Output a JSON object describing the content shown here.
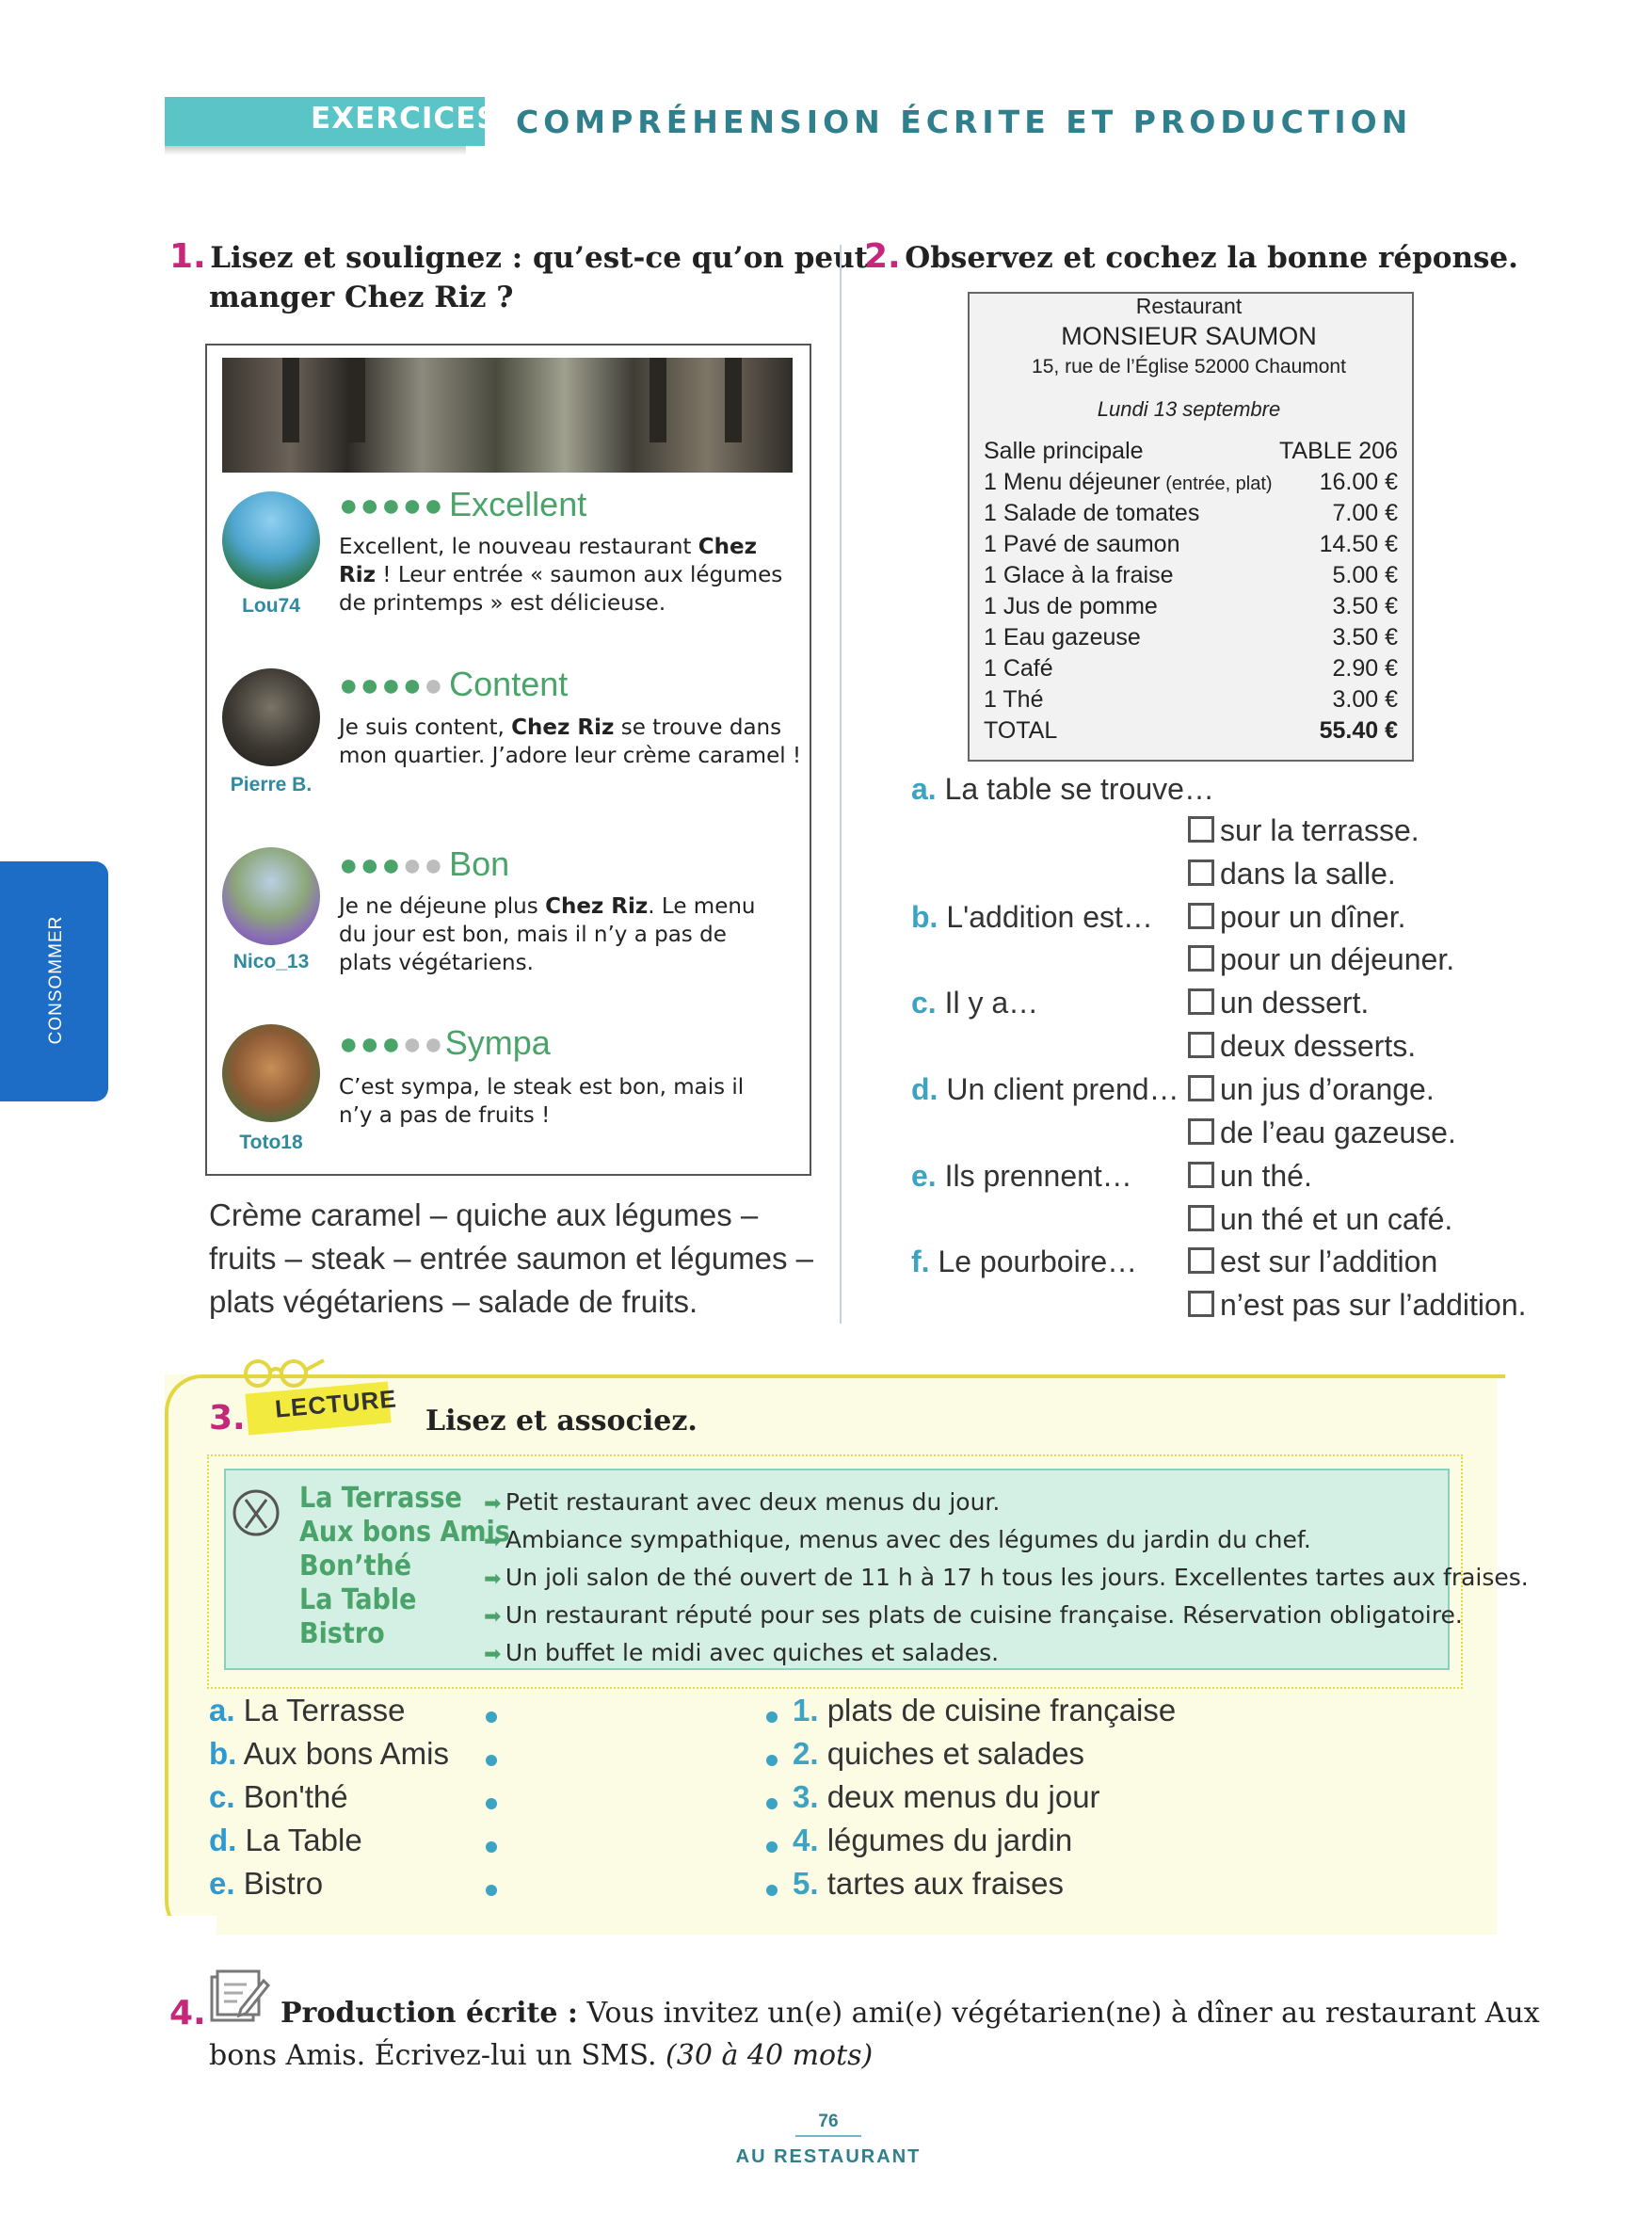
{
  "header": {
    "tag": "EXERCICES",
    "title": "COMPRÉHENSION ÉCRITE ET PRODUCTION"
  },
  "side_tab": "CONSOMMER",
  "ex1": {
    "number": "1.",
    "instruction_line1": "Lisez et soulignez : qu’est-ce qu’on peut",
    "instruction_line2": "manger Chez Riz ?",
    "reviews": [
      {
        "user": "Lou74",
        "title": "Excellent",
        "stars": 5,
        "l1a": "Excellent, le nouveau restaurant ",
        "l1b": "Chez",
        "l2a": "Riz",
        "l2b": " ! Leur entrée « saumon aux légumes",
        "l3": "de printemps » est délicieuse."
      },
      {
        "user": "Pierre B.",
        "title": "Content",
        "stars": 4,
        "l1a": "Je suis content, ",
        "l1b": "Chez Riz",
        "l1c": " se trouve dans",
        "l2": "mon quartier. J’adore leur crème caramel !"
      },
      {
        "user": "Nico_13",
        "title": "Bon",
        "stars": 3,
        "l1a": "Je ne déjeune plus ",
        "l1b": "Chez Riz",
        "l1c": ". Le menu",
        "l2": "du jour est bon, mais il n’y a pas de",
        "l3": "plats végétariens."
      },
      {
        "user": "Toto18",
        "title": "Sympa",
        "stars": 3,
        "l1": "C’est sympa, le steak est bon, mais il",
        "l2": "n’y a pas de fruits !"
      }
    ],
    "food_line1": "Crème caramel – quiche aux légumes –",
    "food_line2": "fruits – steak – entrée saumon et légumes –",
    "food_line3": "plats végétariens – salade de fruits."
  },
  "ex2": {
    "number": "2.",
    "instruction": "Observez et cochez la bonne réponse.",
    "receipt": {
      "label": "Restaurant",
      "name": "MONSIEUR SAUMON",
      "address": "15, rue de l’Église 52000 Chaumont",
      "date": "Lundi 13 septembre",
      "room": "Salle principale",
      "table": "TABLE 206",
      "items": [
        {
          "label": "1 Menu déjeuner",
          "note": " (entrée, plat)",
          "price": "16.00 €"
        },
        {
          "label": "1 Salade de tomates",
          "price": "7.00 €"
        },
        {
          "label": "1 Pavé de saumon",
          "price": "14.50 €"
        },
        {
          "label": "1 Glace à la fraise",
          "price": "5.00 €"
        },
        {
          "label": "1 Jus de pomme",
          "price": "3.50 €"
        },
        {
          "label": "1 Eau gazeuse",
          "price": "3.50 €"
        },
        {
          "label": "1 Café",
          "price": "2.90 €"
        },
        {
          "label": "1 Thé",
          "price": "3.00 €"
        }
      ],
      "total_label": "TOTAL",
      "total": "55.40 €"
    },
    "questions": [
      {
        "letter": "a.",
        "text": " La table se trouve…",
        "options": [
          "sur la terrasse.",
          "dans la salle."
        ]
      },
      {
        "letter": "b.",
        "text": " L'addition est…",
        "options": [
          "pour un dîner.",
          "pour un déjeuner."
        ]
      },
      {
        "letter": "c.",
        "text": " Il y a…",
        "options": [
          "un dessert.",
          "deux desserts."
        ]
      },
      {
        "letter": "d.",
        "text": " Un client prend…",
        "options": [
          "un jus d’orange.",
          "de l’eau gazeuse."
        ]
      },
      {
        "letter": "e.",
        "text": " Ils prennent…",
        "options": [
          "un thé.",
          "un thé et un café."
        ]
      },
      {
        "letter": "f.",
        "text": " Le pourboire…",
        "options": [
          "est sur l’addition",
          "n’est pas sur l’addition."
        ]
      }
    ]
  },
  "ex3": {
    "number": "3.",
    "tag": "LECTURE",
    "instruction": "Lisez et associez.",
    "restaurants": [
      {
        "name": "La Terrasse",
        "desc": "Petit restaurant avec deux menus du jour."
      },
      {
        "name": "Aux bons Amis",
        "desc": "Ambiance sympathique, menus avec des légumes du jardin du chef."
      },
      {
        "name": "Bon’thé",
        "desc": "Un joli salon de thé ouvert de 11 h à 17 h tous les jours. Excellentes tartes aux fraises."
      },
      {
        "name": "La Table",
        "desc": "Un restaurant réputé pour ses plats de cuisine française. Réservation obligatoire."
      },
      {
        "name": "Bistro",
        "desc": "Un buffet le midi avec quiches et salades."
      }
    ],
    "left": [
      {
        "letter": "a.",
        "text": " La Terrasse"
      },
      {
        "letter": "b.",
        "text": " Aux bons Amis"
      },
      {
        "letter": "c.",
        "text": " Bon'thé"
      },
      {
        "letter": "d.",
        "text": " La Table"
      },
      {
        "letter": "e.",
        "text": " Bistro"
      }
    ],
    "right": [
      {
        "num": "1.",
        "text": " plats de cuisine française"
      },
      {
        "num": "2.",
        "text": " quiches et salades"
      },
      {
        "num": "3.",
        "text": " deux menus du jour"
      },
      {
        "num": "4.",
        "text": " légumes du jardin"
      },
      {
        "num": "5.",
        "text": " tartes aux fraises"
      }
    ]
  },
  "ex4": {
    "number": "4.",
    "label": "Production écrite :",
    "text_line1": " Vous invitez un(e) ami(e) végétarien(ne) à dîner au restaurant Aux",
    "text_line2": "bons Amis. Écrivez-lui un SMS. ",
    "words": "(30 à 40 mots)"
  },
  "footer": {
    "page": "76",
    "title": "AU RESTAURANT"
  }
}
